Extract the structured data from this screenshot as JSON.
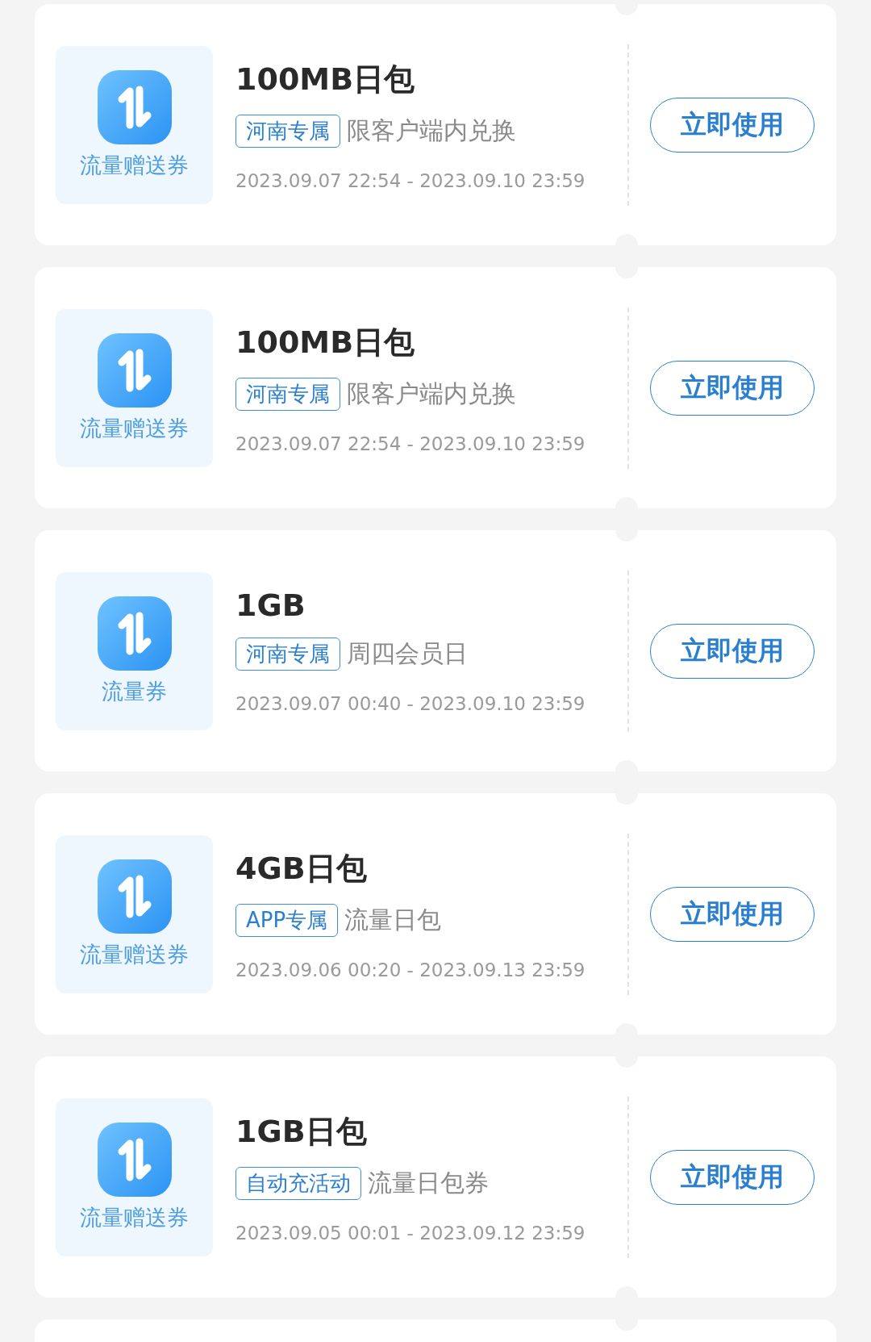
{
  "coupons": [
    {
      "title": "100MB日包",
      "thumb_label": "流量赠送券",
      "tag": "河南专属",
      "note": "限客户端内兑换",
      "validity": "2023.09.07 22:54 - 2023.09.10 23:59",
      "button": "立即使用"
    },
    {
      "title": "100MB日包",
      "thumb_label": "流量赠送券",
      "tag": "河南专属",
      "note": "限客户端内兑换",
      "validity": "2023.09.07 22:54 - 2023.09.10 23:59",
      "button": "立即使用"
    },
    {
      "title": "1GB",
      "thumb_label": "流量券",
      "tag": "河南专属",
      "note": "周四会员日",
      "validity": "2023.09.07 00:40 - 2023.09.10 23:59",
      "button": "立即使用"
    },
    {
      "title": "4GB日包",
      "thumb_label": "流量赠送券",
      "tag": "APP专属",
      "note": "流量日包",
      "validity": "2023.09.06 00:20 - 2023.09.13 23:59",
      "button": "立即使用"
    },
    {
      "title": "1GB日包",
      "thumb_label": "流量赠送券",
      "tag": "自动充活动",
      "note": "流量日包券",
      "validity": "2023.09.05 00:01 - 2023.09.12 23:59",
      "button": "立即使用"
    }
  ]
}
